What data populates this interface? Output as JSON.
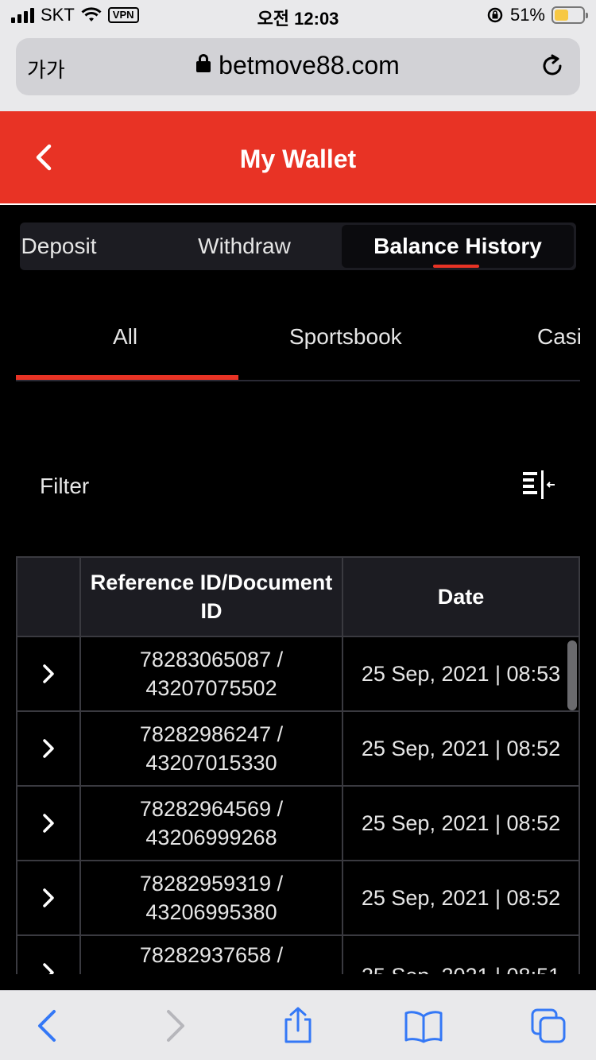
{
  "status_bar": {
    "carrier": "SKT",
    "vpn": "VPN",
    "time": "오전 12:03",
    "battery": "51%"
  },
  "browser": {
    "text_size": "가가",
    "url": "betmove88.com"
  },
  "header": {
    "title": "My Wallet"
  },
  "wallet_tabs": [
    {
      "label": "Deposit"
    },
    {
      "label": "Withdraw"
    },
    {
      "label": "Balance History",
      "active": true
    }
  ],
  "category_tabs": [
    {
      "label": "All",
      "active": true
    },
    {
      "label": "Sportsbook"
    },
    {
      "label": "Casi"
    }
  ],
  "filter": {
    "label": "Filter"
  },
  "table": {
    "headers": {
      "reference": "Reference ID/Document ID",
      "date": "Date"
    },
    "rows": [
      {
        "reference": "78283065087 / 43207075502",
        "date": "25 Sep, 2021 | 08:53"
      },
      {
        "reference": "78282986247 / 43207015330",
        "date": "25 Sep, 2021 | 08:52"
      },
      {
        "reference": "78282964569 / 43206999268",
        "date": "25 Sep, 2021 | 08:52"
      },
      {
        "reference": "78282959319 / 43206995380",
        "date": "25 Sep, 2021 | 08:52"
      },
      {
        "reference": "78282937658 /",
        "date": "25 Sep, 2021 | 08:51"
      }
    ]
  },
  "colors": {
    "brand_red": "#e83325",
    "background": "#000000",
    "ios_blue": "#3478f6"
  }
}
